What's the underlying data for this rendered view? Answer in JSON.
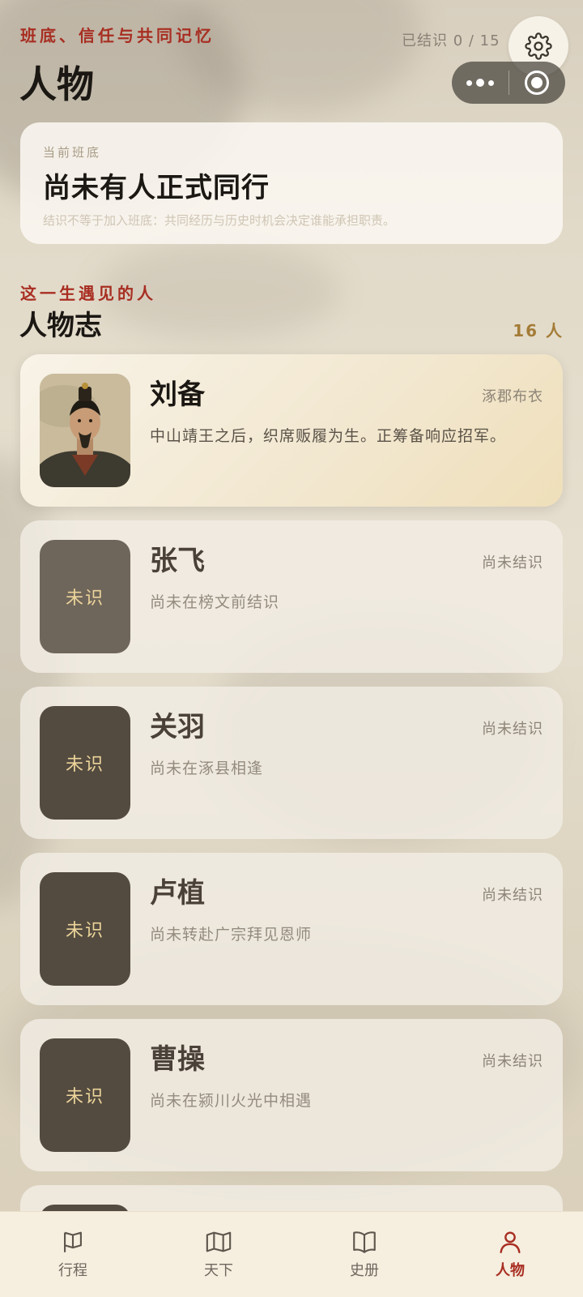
{
  "header": {
    "kicker": "班底、信任与共同记忆",
    "title": "人物",
    "met_count": "已结识 0 / 15"
  },
  "roster": {
    "label": "当前班底",
    "title": "尚未有人正式同行",
    "note": "结识不等于加入班底：共同经历与历史时机会决定谁能承担职责。"
  },
  "section": {
    "kicker": "这一生遇见的人",
    "title": "人物志",
    "count": "16 人"
  },
  "characters": [
    {
      "name": "刘备",
      "tag": "涿郡布衣",
      "desc": "中山靖王之后，织席贩履为生。正筹备响应招军。",
      "met": true,
      "avatar_text": ""
    },
    {
      "name": "张飞",
      "tag": "尚未结识",
      "desc": "尚未在榜文前结识",
      "met": false,
      "avatar_text": "未识"
    },
    {
      "name": "关羽",
      "tag": "尚未结识",
      "desc": "尚未在涿县相逢",
      "met": false,
      "avatar_text": "未识"
    },
    {
      "name": "卢植",
      "tag": "尚未结识",
      "desc": "尚未转赴广宗拜见恩师",
      "met": false,
      "avatar_text": "未识"
    },
    {
      "name": "曹操",
      "tag": "尚未结识",
      "desc": "尚未在颍川火光中相遇",
      "met": false,
      "avatar_text": "未识"
    }
  ],
  "tabs": [
    {
      "label": "行程",
      "icon": "flag-icon",
      "active": false
    },
    {
      "label": "天下",
      "icon": "map-icon",
      "active": false
    },
    {
      "label": "史册",
      "icon": "book-icon",
      "active": false
    },
    {
      "label": "人物",
      "icon": "person-icon",
      "active": true
    }
  ],
  "colors": {
    "accent_red": "#a82e22",
    "gold": "#a47c37",
    "tabbar_bg": "#f6eedf"
  }
}
